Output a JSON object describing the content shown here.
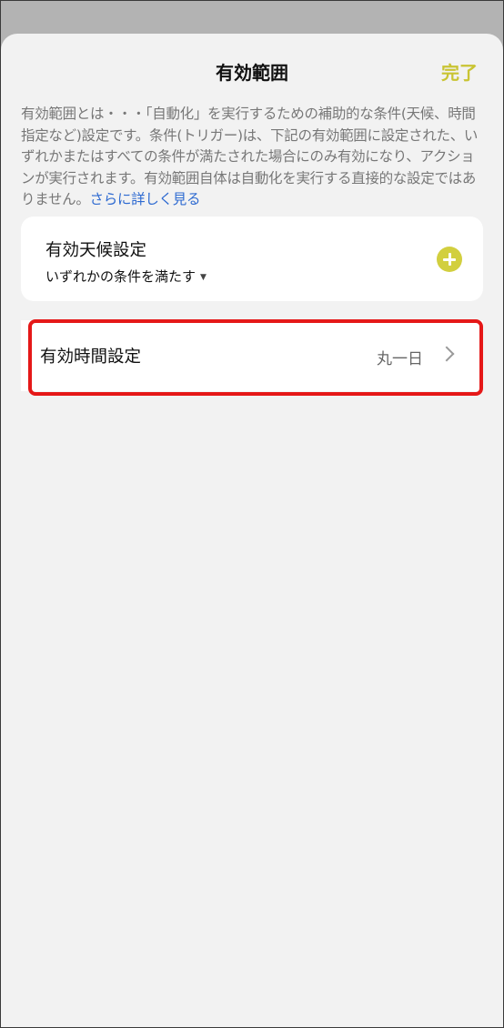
{
  "header": {
    "title": "有効範囲",
    "done_label": "完了"
  },
  "description": {
    "text": "有効範囲とは・・・「自動化」を実行するための補助的な条件(天候、時間指定など)設定です。条件(トリガー)は、下記の有効範囲に設定された、いずれかまたはすべての条件が満たされた場合にのみ有効になり、アクションが実行されます。有効範囲自体は自動化を実行する直接的な設定ではありません。",
    "more_link": "さらに詳しく見る"
  },
  "weather": {
    "title": "有効天候設定",
    "condition": "いずれかの条件を満たす",
    "caret_icon": "chevron-down-icon",
    "add_icon": "plus-circle-icon"
  },
  "time": {
    "label": "有効時間設定",
    "value": "丸一日",
    "chevron_icon": "chevron-right-icon"
  },
  "colors": {
    "accent": "#c9c433",
    "plus_button": "#d2cf3f",
    "link": "#2f6bd1",
    "highlight": "#e51818"
  }
}
